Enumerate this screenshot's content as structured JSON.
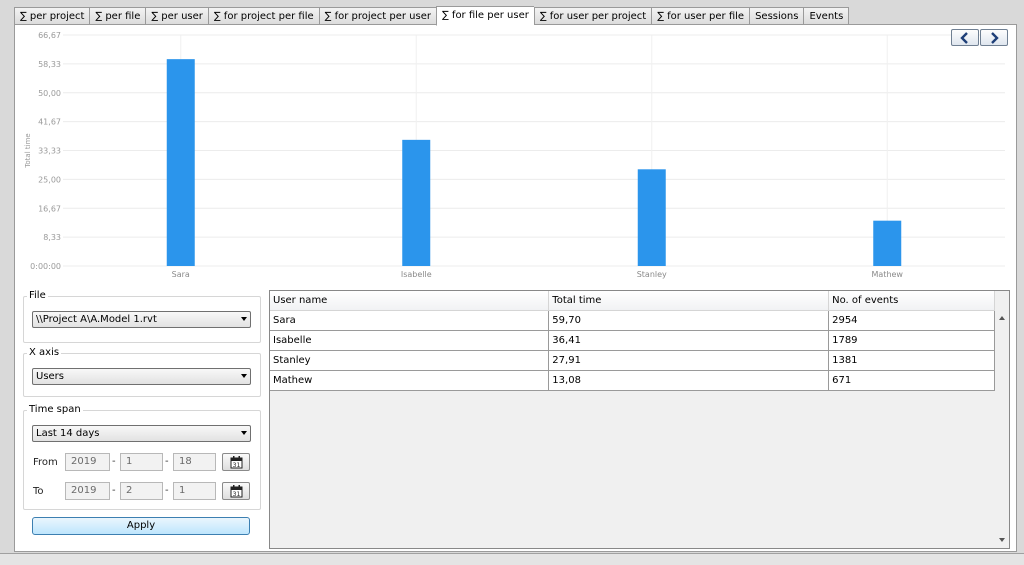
{
  "tabs": [
    {
      "label": "∑ per project",
      "active": false
    },
    {
      "label": "∑ per file",
      "active": false
    },
    {
      "label": "∑ per user",
      "active": false
    },
    {
      "label": "∑ for project per file",
      "active": false
    },
    {
      "label": "∑ for project per user",
      "active": false
    },
    {
      "label": "∑ for file per user",
      "active": true
    },
    {
      "label": "∑ for user per project",
      "active": false
    },
    {
      "label": "∑ for user per file",
      "active": false
    },
    {
      "label": "Sessions",
      "active": false
    },
    {
      "label": "Events",
      "active": false
    }
  ],
  "nav": {
    "prev_icon": "chevron-left-icon",
    "next_icon": "chevron-right-icon",
    "color": "#1f3f78"
  },
  "chart_data": {
    "type": "bar",
    "categories": [
      "Sara",
      "Isabelle",
      "Stanley",
      "Mathew"
    ],
    "values": [
      59.7,
      36.41,
      27.91,
      13.08
    ],
    "ylabel": "Total time",
    "yticks": [
      "0:00:00",
      "8,33",
      "16,67",
      "25,00",
      "33,33",
      "41,67",
      "50,00",
      "58,33",
      "66,67"
    ],
    "ylim": [
      0,
      66.67
    ],
    "bar_color": "#2b95ec",
    "grid": true
  },
  "filters": {
    "file": {
      "label": "File",
      "value": "\\\\Project A\\A.Model 1.rvt"
    },
    "xaxis": {
      "label": "X axis",
      "value": "Users"
    },
    "timespan": {
      "label": "Time span",
      "value": "Last 14 days",
      "from": {
        "label": "From",
        "year": "2019",
        "month": "1",
        "day": "18"
      },
      "to": {
        "label": "To",
        "year": "2019",
        "month": "2",
        "day": "1"
      },
      "calendar_icon": "calendar-icon"
    },
    "apply_label": "Apply"
  },
  "table": {
    "columns": [
      "User name",
      "Total time",
      "No. of events"
    ],
    "rows": [
      [
        "Sara",
        "59,70",
        "2954"
      ],
      [
        "Isabelle",
        "36,41",
        "1789"
      ],
      [
        "Stanley",
        "27,91",
        "1381"
      ],
      [
        "Mathew",
        "13,08",
        "671"
      ]
    ]
  }
}
